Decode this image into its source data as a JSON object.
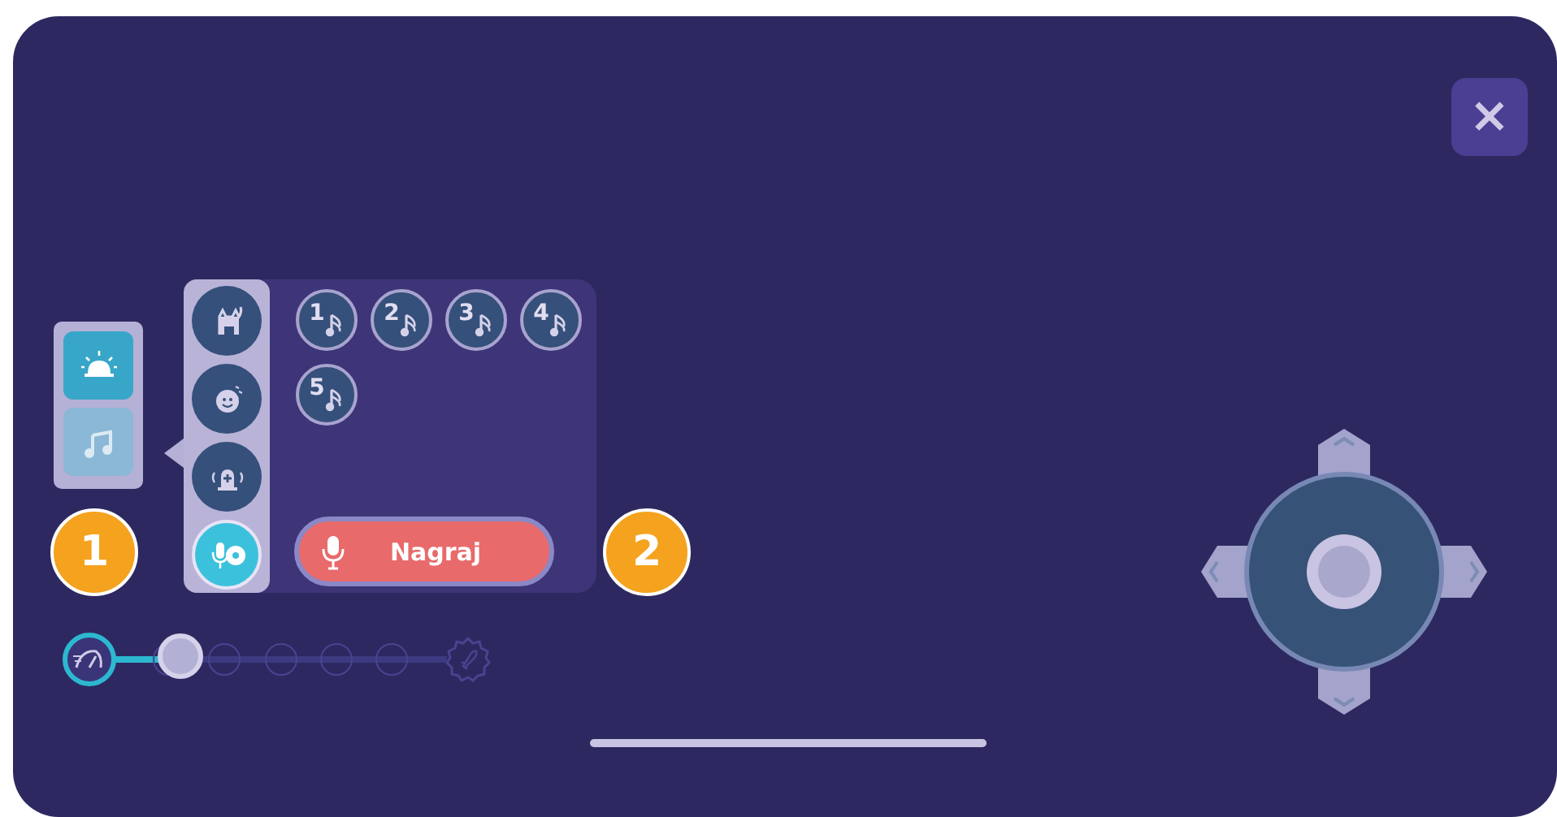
{
  "close_button": {
    "label": "×"
  },
  "categories": [
    {
      "kind": "alarm",
      "selected": false
    },
    {
      "kind": "music",
      "selected": true
    }
  ],
  "sound_groups": [
    {
      "kind": "cat",
      "selected": false
    },
    {
      "kind": "baby",
      "selected": false
    },
    {
      "kind": "siren",
      "selected": false
    },
    {
      "kind": "recorder",
      "selected": true
    }
  ],
  "sounds": [
    {
      "label": "1"
    },
    {
      "label": "2"
    },
    {
      "label": "3"
    },
    {
      "label": "4"
    },
    {
      "label": "5"
    }
  ],
  "record_button": {
    "label": "Nagraj"
  },
  "callouts": [
    {
      "label": "1"
    },
    {
      "label": "2"
    }
  ],
  "speed_slider": {
    "level": 0.2
  }
}
